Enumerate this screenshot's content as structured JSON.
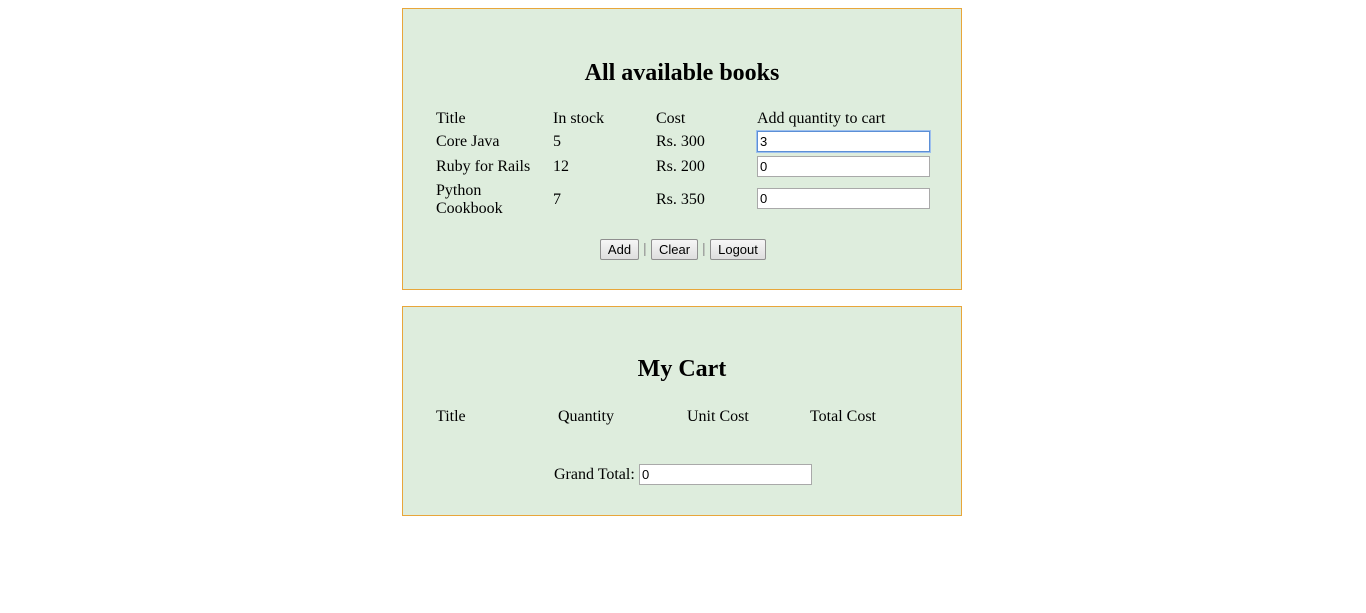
{
  "books": {
    "heading": "All available books",
    "columns": [
      "Title",
      "In stock",
      "Cost",
      "Add quantity to cart"
    ],
    "rows": [
      {
        "title": "Core Java",
        "stock": "5",
        "cost": "Rs. 300",
        "qty": "3"
      },
      {
        "title": "Ruby for Rails",
        "stock": "12",
        "cost": "Rs. 200",
        "qty": "0"
      },
      {
        "title_line1": "Python",
        "title_line2": "Cookbook",
        "stock": "7",
        "cost": "Rs. 350",
        "qty": "0"
      }
    ],
    "buttons": {
      "add": "Add",
      "clear": "Clear",
      "logout": "Logout"
    },
    "separator": "|"
  },
  "cart": {
    "heading": "My Cart",
    "columns": [
      "Title",
      "Quantity",
      "Unit Cost",
      "Total Cost"
    ],
    "grand_total_label": "Grand Total:",
    "grand_total_value": "0"
  },
  "colors": {
    "panel_background": "#deeddd",
    "panel_border": "#e8a63a"
  }
}
